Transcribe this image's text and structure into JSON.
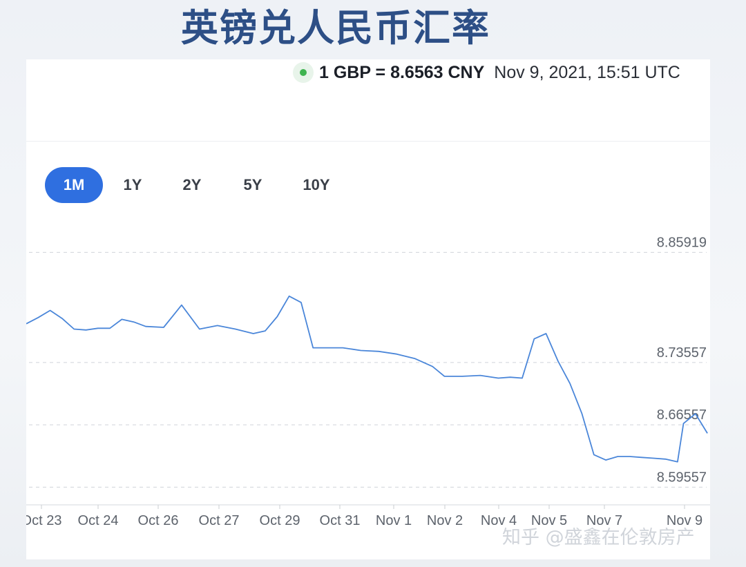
{
  "page_title": "英镑兑人民币汇率",
  "rate_header": {
    "rate_text": "1 GBP = 8.6563 CNY",
    "timestamp": "Nov 9, 2021, 15:51 UTC",
    "status_color": "#3fb450"
  },
  "range_tabs": [
    {
      "label": "1M",
      "active": true
    },
    {
      "label": "1Y",
      "active": false
    },
    {
      "label": "2Y",
      "active": false
    },
    {
      "label": "5Y",
      "active": false
    },
    {
      "label": "10Y",
      "active": false
    }
  ],
  "watermark": "知乎 @盛鑫在伦敦房产",
  "chart_data": {
    "type": "line",
    "title": "",
    "xlabel": "",
    "ylabel": "",
    "line_color": "#4a86d9",
    "grid": "dashed-horizontal",
    "y_ticks": [
      8.59557,
      8.66557,
      8.73557,
      8.85919
    ],
    "x_ticks": [
      "Oct 23",
      "Oct 24",
      "Oct 26",
      "Oct 27",
      "Oct 29",
      "Oct 31",
      "Nov 1",
      "Nov 2",
      "Nov 4",
      "Nov 5",
      "Nov 7",
      "Nov 9"
    ],
    "ylim": [
      8.585,
      8.875
    ],
    "series": [
      {
        "x": [
          0,
          0.2,
          0.4,
          0.6,
          0.8,
          1,
          1.2,
          1.4,
          1.6,
          1.8,
          2,
          2.3,
          2.6,
          2.9,
          3.2,
          3.5,
          3.8,
          4,
          4.2,
          4.4,
          4.6,
          4.8,
          5,
          5.3,
          5.6,
          5.9,
          6.2,
          6.5,
          6.8,
          7,
          7.3,
          7.6,
          7.9,
          8.1,
          8.3,
          8.5,
          8.7,
          8.9,
          9.1,
          9.3,
          9.5,
          9.7,
          9.9,
          10.1,
          10.3,
          10.5,
          10.7,
          10.9,
          11,
          11.2,
          11.4
        ],
        "values": [
          8.779,
          8.786,
          8.794,
          8.785,
          8.773,
          8.772,
          8.774,
          8.774,
          8.784,
          8.781,
          8.776,
          8.775,
          8.8,
          8.773,
          8.777,
          8.773,
          8.768,
          8.771,
          8.787,
          8.81,
          8.803,
          8.752,
          8.752,
          8.752,
          8.749,
          8.748,
          8.745,
          8.74,
          8.731,
          8.72,
          8.72,
          8.721,
          8.718,
          8.719,
          8.718,
          8.762,
          8.768,
          8.737,
          8.712,
          8.678,
          8.632,
          8.626,
          8.63,
          8.63,
          8.629,
          8.628,
          8.627,
          8.624,
          8.667,
          8.678,
          8.656
        ]
      }
    ]
  }
}
